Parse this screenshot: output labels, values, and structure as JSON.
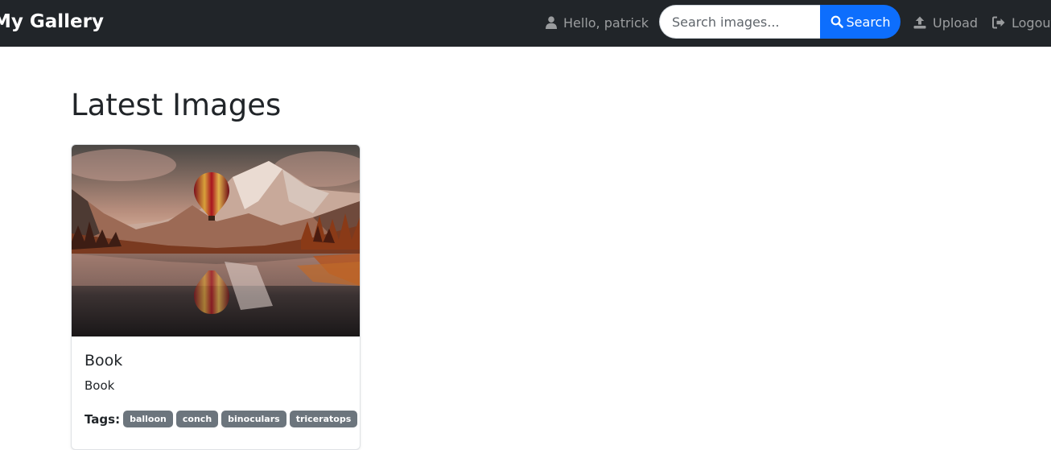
{
  "navbar": {
    "brand": "My Gallery",
    "greeting": "Hello, patrick",
    "search": {
      "placeholder": "Search images...",
      "button_label": "Search"
    },
    "upload_label": "Upload",
    "logout_label": "Logout"
  },
  "main": {
    "title": "Latest Images",
    "cards": [
      {
        "title": "Book",
        "description": "Book",
        "tags_label": "Tags:",
        "tags": [
          "balloon",
          "conch",
          "binoculars",
          "triceratops"
        ]
      }
    ]
  },
  "colors": {
    "navbar_bg": "#212529",
    "primary": "#0d6efd",
    "badge_bg": "#6c757d"
  },
  "icons": {
    "user": "user-icon",
    "search": "search-icon",
    "upload": "upload-icon",
    "logout": "logout-icon"
  }
}
